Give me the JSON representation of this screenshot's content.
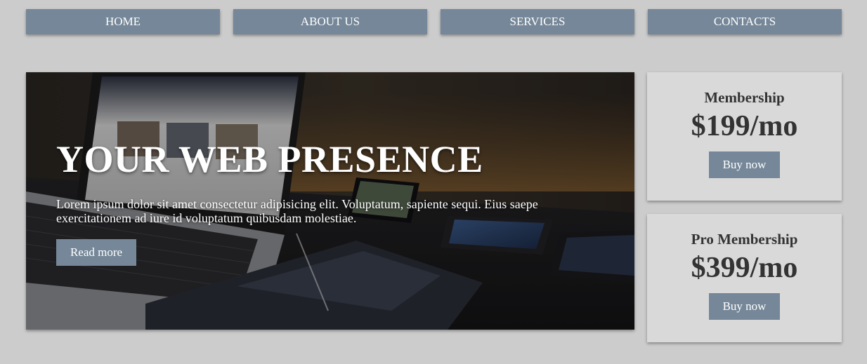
{
  "nav": {
    "items": [
      {
        "label": "HOME"
      },
      {
        "label": "ABOUT US"
      },
      {
        "label": "SERVICES"
      },
      {
        "label": "CONTACTS"
      }
    ]
  },
  "hero": {
    "title": "YOUR WEB PRESENCE",
    "text": "Lorem ipsum dolor sit amet consectetur adipisicing elit. Voluptatum, sapiente sequi. Eius saepe exercitationem ad iure id voluptatum quibusdam molestiae.",
    "button_label": "Read more"
  },
  "plans": [
    {
      "name": "Membership",
      "price": "$199/mo",
      "button_label": "Buy now"
    },
    {
      "name": "Pro Membership",
      "price": "$399/mo",
      "button_label": "Buy now"
    }
  ],
  "colors": {
    "page_background": "#cccccc",
    "accent": "#758798",
    "card_background": "#d9d9d9",
    "text_dark": "#333333"
  }
}
